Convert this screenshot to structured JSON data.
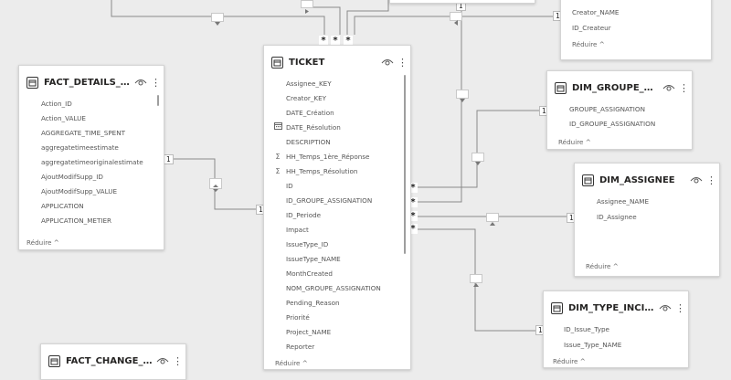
{
  "tables": {
    "top_right": {
      "fields": [
        "Creator_NAME",
        "ID_Createur"
      ],
      "reduire": "Réduire ^"
    },
    "fact_details": {
      "title": "FACT_DETAILS_MENS...",
      "fields": [
        "Action_ID",
        "Action_VALUE",
        "AGGREGATE_TIME_SPENT",
        "aggregatetimeestimate",
        "aggregatetimeoriginalestimate",
        "AjoutModifSupp_ID",
        "AjoutModifSupp_VALUE",
        "APPLICATION",
        "APPLICATION_METIER"
      ],
      "reduire": "Réduire ^"
    },
    "ticket": {
      "title": "TICKET",
      "fields": [
        {
          "name": "Assignee_KEY",
          "icon": ""
        },
        {
          "name": "Creator_KEY",
          "icon": ""
        },
        {
          "name": "DATE_Création",
          "icon": ""
        },
        {
          "name": "DATE_Résolution",
          "icon": "calendar"
        },
        {
          "name": "DESCRIPTION",
          "icon": ""
        },
        {
          "name": "HH_Temps_1ère_Réponse",
          "icon": "sigma"
        },
        {
          "name": "HH_Temps_Résolution",
          "icon": "sigma"
        },
        {
          "name": "ID",
          "icon": ""
        },
        {
          "name": "ID_GROUPE_ASSIGNATION",
          "icon": ""
        },
        {
          "name": "ID_Periode",
          "icon": ""
        },
        {
          "name": "Impact",
          "icon": ""
        },
        {
          "name": "IssueType_ID",
          "icon": ""
        },
        {
          "name": "IssueType_NAME",
          "icon": ""
        },
        {
          "name": "MonthCreated",
          "icon": ""
        },
        {
          "name": "NOM_GROUPE_ASSIGNATION",
          "icon": ""
        },
        {
          "name": "Pending_Reason",
          "icon": ""
        },
        {
          "name": "Priorité",
          "icon": ""
        },
        {
          "name": "Project_NAME",
          "icon": ""
        },
        {
          "name": "Reporter",
          "icon": ""
        }
      ],
      "reduire": "Réduire ^"
    },
    "dim_groupe": {
      "title": "DIM_GROUPE_ASSIG...",
      "fields": [
        "GROUPE_ASSIGNATION",
        "ID_GROUPE_ASSIGNATION"
      ],
      "reduire": "Réduire ^"
    },
    "dim_assignee": {
      "title": "DIM_ASSIGNEE",
      "fields": [
        "Assignee_NAME",
        "ID_Assignee"
      ],
      "reduire": "Réduire ^"
    },
    "dim_type": {
      "title": "DIM_TYPE_INCIDENT",
      "fields": [
        "ID_Issue_Type",
        "Issue_Type_NAME"
      ],
      "reduire": "Réduire ^"
    },
    "fact_change": {
      "title": "FACT_CHANGE_STATUT"
    }
  },
  "cardinality": {
    "one": "1",
    "many": "*"
  },
  "more_glyph": "⋮"
}
